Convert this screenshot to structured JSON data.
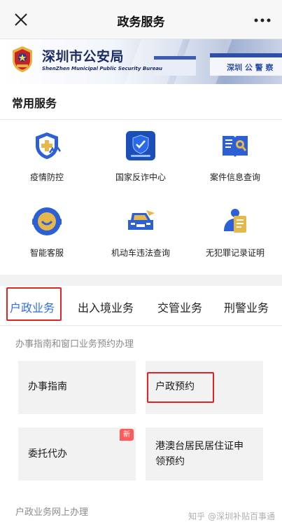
{
  "header": {
    "title": "政务服务"
  },
  "banner": {
    "org_name": "深圳市公安局",
    "org_name_en": "ShenZhen Municipal Public Security Bureau",
    "van_text": "深圳 公 警 察"
  },
  "common_services": {
    "title": "常用服务",
    "items": [
      {
        "label": "疫情防控",
        "icon": "shield-cross-icon"
      },
      {
        "label": "国家反诈中心",
        "icon": "anti-fraud-app-icon"
      },
      {
        "label": "案件信息查询",
        "icon": "book-search-icon"
      },
      {
        "label": "智能客服",
        "icon": "smile-bot-icon"
      },
      {
        "label": "机动车违法查询",
        "icon": "car-icon"
      },
      {
        "label": "无犯罪记录证明",
        "icon": "certificate-icon"
      }
    ]
  },
  "tabs": [
    {
      "label": "户政业务",
      "active": true
    },
    {
      "label": "出入境业务",
      "active": false
    },
    {
      "label": "交管业务",
      "active": false
    },
    {
      "label": "刑警业务",
      "active": false
    }
  ],
  "section": {
    "subtitle": "办事指南和窗口业务预约办理",
    "cards": [
      {
        "label": "办事指南",
        "badge": ""
      },
      {
        "label": "户政预约",
        "badge": ""
      },
      {
        "label": "委托代办",
        "badge": "新"
      },
      {
        "label": "港澳台居民居住证申领预约",
        "line1": "港澳台居民居住证申",
        "line2": "领预约",
        "badge": ""
      }
    ],
    "bottom_subtitle": "户政业务网上办理"
  },
  "watermark": "知乎 @深圳补贴百事通",
  "colors": {
    "accent_blue": "#2f6fe0",
    "highlight_red": "#e02424",
    "icon_blue": "#2d5fd6",
    "icon_gold": "#e6b84a"
  }
}
